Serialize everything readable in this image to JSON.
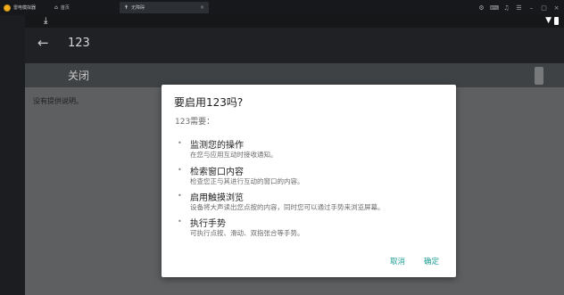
{
  "chrome": {
    "app_name": "雷电模拟器",
    "tabs": [
      {
        "icon": "⌂",
        "label": "首页"
      },
      {
        "icon": "✝",
        "label": "无障碍",
        "close": "×"
      }
    ],
    "actions": [
      "⚙",
      "⌨",
      "♫",
      "☰",
      "–",
      "▢",
      "×"
    ]
  },
  "statusbar": {
    "download_icon": "⤓",
    "wifi_icon": "▼"
  },
  "actionbar": {
    "back": "←",
    "title": "123"
  },
  "switchbar": {
    "label": "关闭"
  },
  "content": {
    "description": "没有提供说明。"
  },
  "dialog": {
    "title": "要启用123吗?",
    "subtitle": "123需要：",
    "permissions": [
      {
        "bullet": "•",
        "title": "监测您的操作",
        "desc": "在您与应用互动时接收通知。"
      },
      {
        "bullet": "•",
        "title": "检索窗口内容",
        "desc": "检查您正与其进行互动的窗口的内容。"
      },
      {
        "bullet": "•",
        "title": "启用触摸浏览",
        "desc": "设备将大声读出您点按的内容，同时您可以通过手势来浏览屏幕。"
      },
      {
        "bullet": "•",
        "title": "执行手势",
        "desc": "可执行点按、滑动、双指张合等手势。"
      }
    ],
    "cancel_label": "取消",
    "ok_label": "确定"
  },
  "colors": {
    "accent": "#1f9e94",
    "dialog_bg": "#ffffff",
    "scrim": "#5c5e60"
  }
}
